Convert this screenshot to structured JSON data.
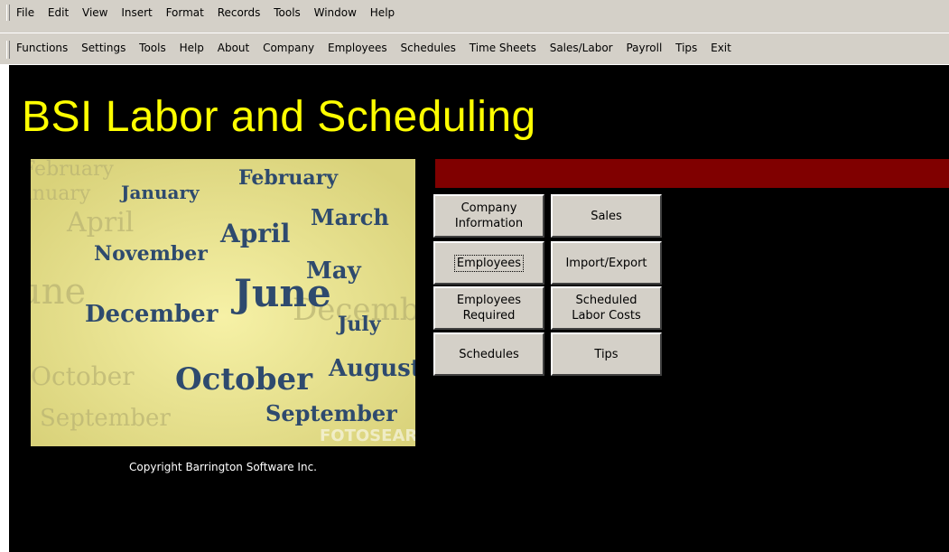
{
  "menubar": {
    "items": [
      "File",
      "Edit",
      "View",
      "Insert",
      "Format",
      "Records",
      "Tools",
      "Window",
      "Help"
    ]
  },
  "toolbar": {
    "items": [
      "Functions",
      "Settings",
      "Tools",
      "Help",
      "About",
      "Company",
      "Employees",
      "Schedules",
      "Time Sheets",
      "Sales/Labor",
      "Payroll",
      "Tips",
      "Exit"
    ]
  },
  "main": {
    "title": "BSI Labor and Scheduling",
    "copyright": "Copyright Barrington Software Inc.",
    "watermark": "FOTOSEARCH.com",
    "buttons": {
      "company_information": "Company\nInformation",
      "sales": "Sales",
      "employees": "Employees",
      "import_export": "Import/Export",
      "employees_required": "Employees\nRequired",
      "scheduled_labor_costs": "Scheduled\nLabor Costs",
      "schedules": "Schedules",
      "tips": "Tips"
    },
    "month_words": [
      "February",
      "January",
      "March",
      "April",
      "November",
      "May",
      "June",
      "December",
      "July",
      "August",
      "October",
      "September"
    ]
  },
  "colors": {
    "background": "#000000",
    "title": "#ffff00",
    "accent_bar": "#800000",
    "chrome": "#d4d0c8"
  }
}
